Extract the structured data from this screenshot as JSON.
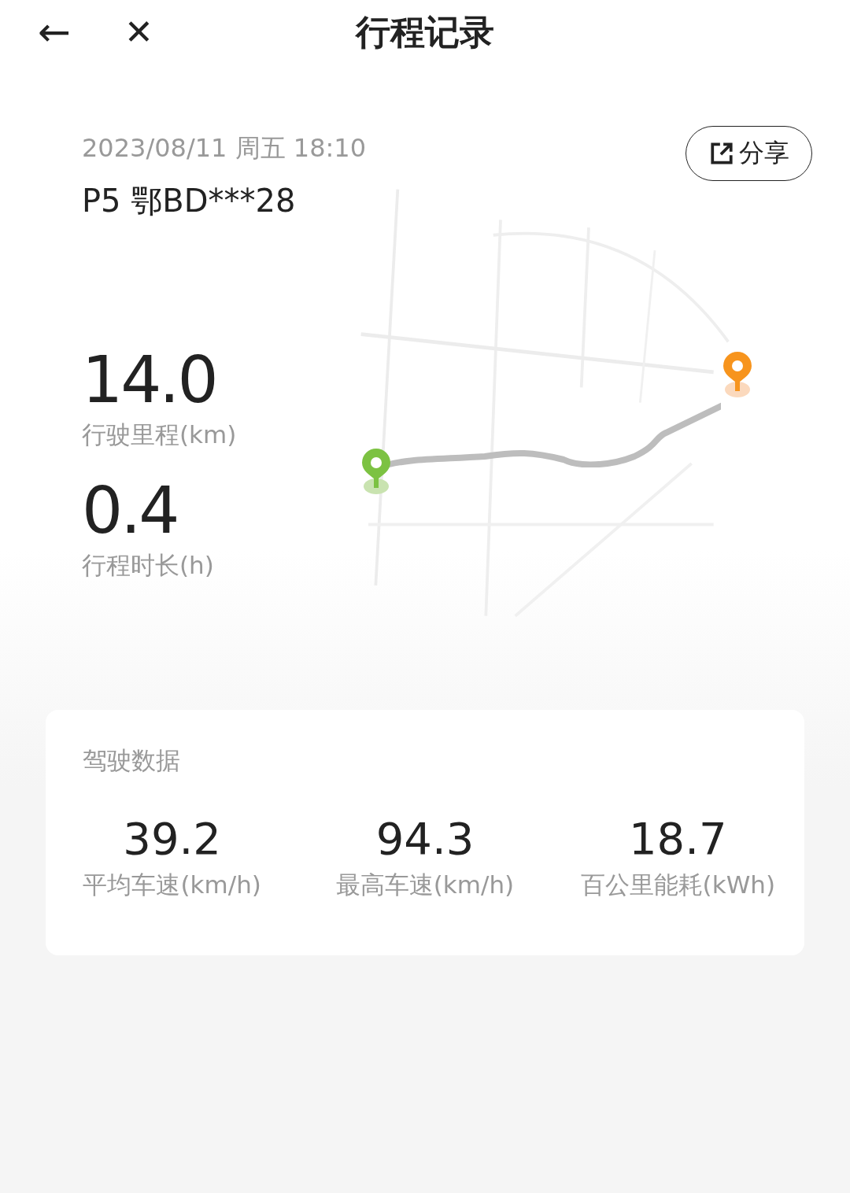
{
  "header": {
    "back_icon": "←",
    "close_icon": "✕",
    "title": "行程记录"
  },
  "trip": {
    "datetime": "2023/08/11 周五 18:10",
    "vehicle": "P5 鄂BD***28",
    "share_label": "分享",
    "stats": [
      {
        "value": "14.0",
        "label": "行驶里程(km)"
      },
      {
        "value": "0.4",
        "label": "行程时长(h)"
      }
    ]
  },
  "driving_data": {
    "title": "驾驶数据",
    "metrics": [
      {
        "value": "39.2",
        "label": "平均车速(km/h)"
      },
      {
        "value": "94.3",
        "label": "最高车速(km/h)"
      },
      {
        "value": "18.7",
        "label": "百公里能耗(kWh)"
      }
    ]
  }
}
